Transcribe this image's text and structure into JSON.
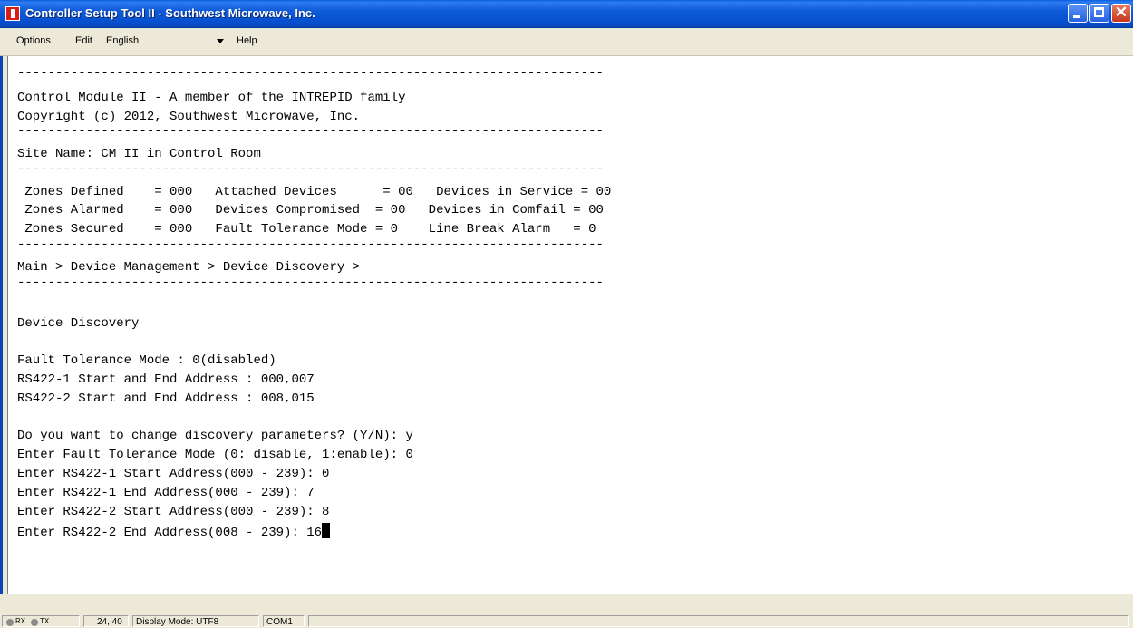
{
  "window": {
    "title": "Controller Setup Tool II - Southwest Microwave, Inc.",
    "icon": "app-logo-icon"
  },
  "menu": {
    "options": "Options",
    "edit": "Edit",
    "language_selected": "English",
    "help": "Help"
  },
  "terminal": {
    "lines": [
      "-----------------------------------------------------------------------------",
      "Control Module II - A member of the INTREPID family",
      "Copyright (c) 2012, Southwest Microwave, Inc.",
      "-----------------------------------------------------------------------------",
      "Site Name: CM II in Control Room",
      "-----------------------------------------------------------------------------",
      " Zones Defined    = 000   Attached Devices      = 00   Devices in Service = 00",
      " Zones Alarmed    = 000   Devices Compromised  = 00   Devices in Comfail = 00",
      " Zones Secured    = 000   Fault Tolerance Mode = 0    Line Break Alarm   = 0",
      "-----------------------------------------------------------------------------",
      "Main > Device Management > Device Discovery >",
      "-----------------------------------------------------------------------------",
      "",
      "Device Discovery",
      "",
      "Fault Tolerance Mode : 0(disabled)",
      "RS422-1 Start and End Address : 000,007",
      "RS422-2 Start and End Address : 008,015",
      "",
      "Do you want to change discovery parameters? (Y/N): y",
      "Enter Fault Tolerance Mode (0: disable, 1:enable): 0",
      "Enter RS422-1 Start Address(000 - 239): 0",
      "Enter RS422-1 End Address(000 - 239): 7",
      "Enter RS422-2 Start Address(000 - 239): 8",
      "Enter RS422-2 End Address(008 - 239): 16"
    ]
  },
  "statusbar": {
    "rx": "RX",
    "tx": "TX",
    "cursor_pos": "24, 40",
    "display_mode": "Display Mode: UTF8",
    "port": "COM1"
  }
}
